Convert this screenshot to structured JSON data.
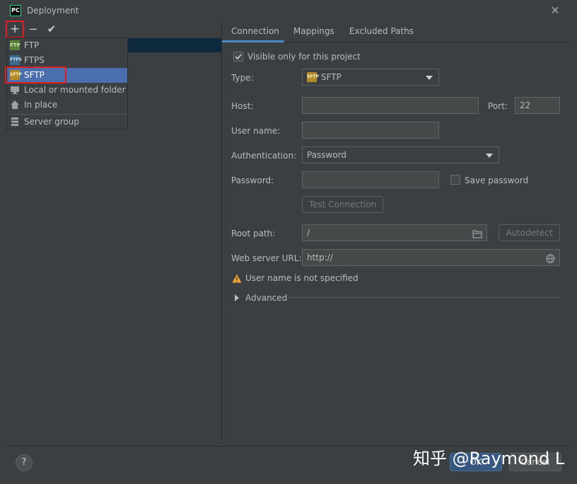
{
  "window": {
    "title": "Deployment",
    "app_icon": "PC"
  },
  "toolbar": {
    "add": "+",
    "remove": "−",
    "apply": "✔"
  },
  "add_menu": {
    "items": [
      {
        "label": "FTP",
        "icon": "ftp-icon"
      },
      {
        "label": "FTPS",
        "icon": "ftps-icon"
      },
      {
        "label": "SFTP",
        "icon": "sftp-icon",
        "selected": true
      },
      {
        "label": "Local or mounted folder",
        "icon": "folder-icon"
      },
      {
        "label": "In place",
        "icon": "home-icon"
      }
    ],
    "group_item": {
      "label": "Server group",
      "icon": "server-group-icon"
    },
    "icon_texts": {
      "ftp": "FTP",
      "ftps": "FTPS",
      "sftp": "SFTP"
    }
  },
  "tabs": [
    "Connection",
    "Mappings",
    "Excluded Paths"
  ],
  "form": {
    "visible_only_label": "Visible only for this project",
    "type_label": "Type:",
    "type_value": "SFTP",
    "host_label": "Host:",
    "host_value": "",
    "port_label": "Port:",
    "port_value": "22",
    "username_label": "User name:",
    "username_value": "",
    "auth_label": "Authentication:",
    "auth_value": "Password",
    "password_label": "Password:",
    "password_value": "",
    "save_password_label": "Save password",
    "test_connection": "Test Connection",
    "root_path_label": "Root path:",
    "root_path_value": "/",
    "autodetect": "Autodetect",
    "web_url_label": "Web server URL:",
    "web_url_value": "http://",
    "warning": "User name is not specified",
    "advanced": "Advanced"
  },
  "footer": {
    "help": "?",
    "ok": "OK",
    "cancel": "Cancel"
  },
  "watermark": "知乎 @Raymond L",
  "colors": {
    "accent": "#4a88c7",
    "selection": "#4b6eaf",
    "highlight": "#e02020",
    "background": "#3c3f41"
  }
}
